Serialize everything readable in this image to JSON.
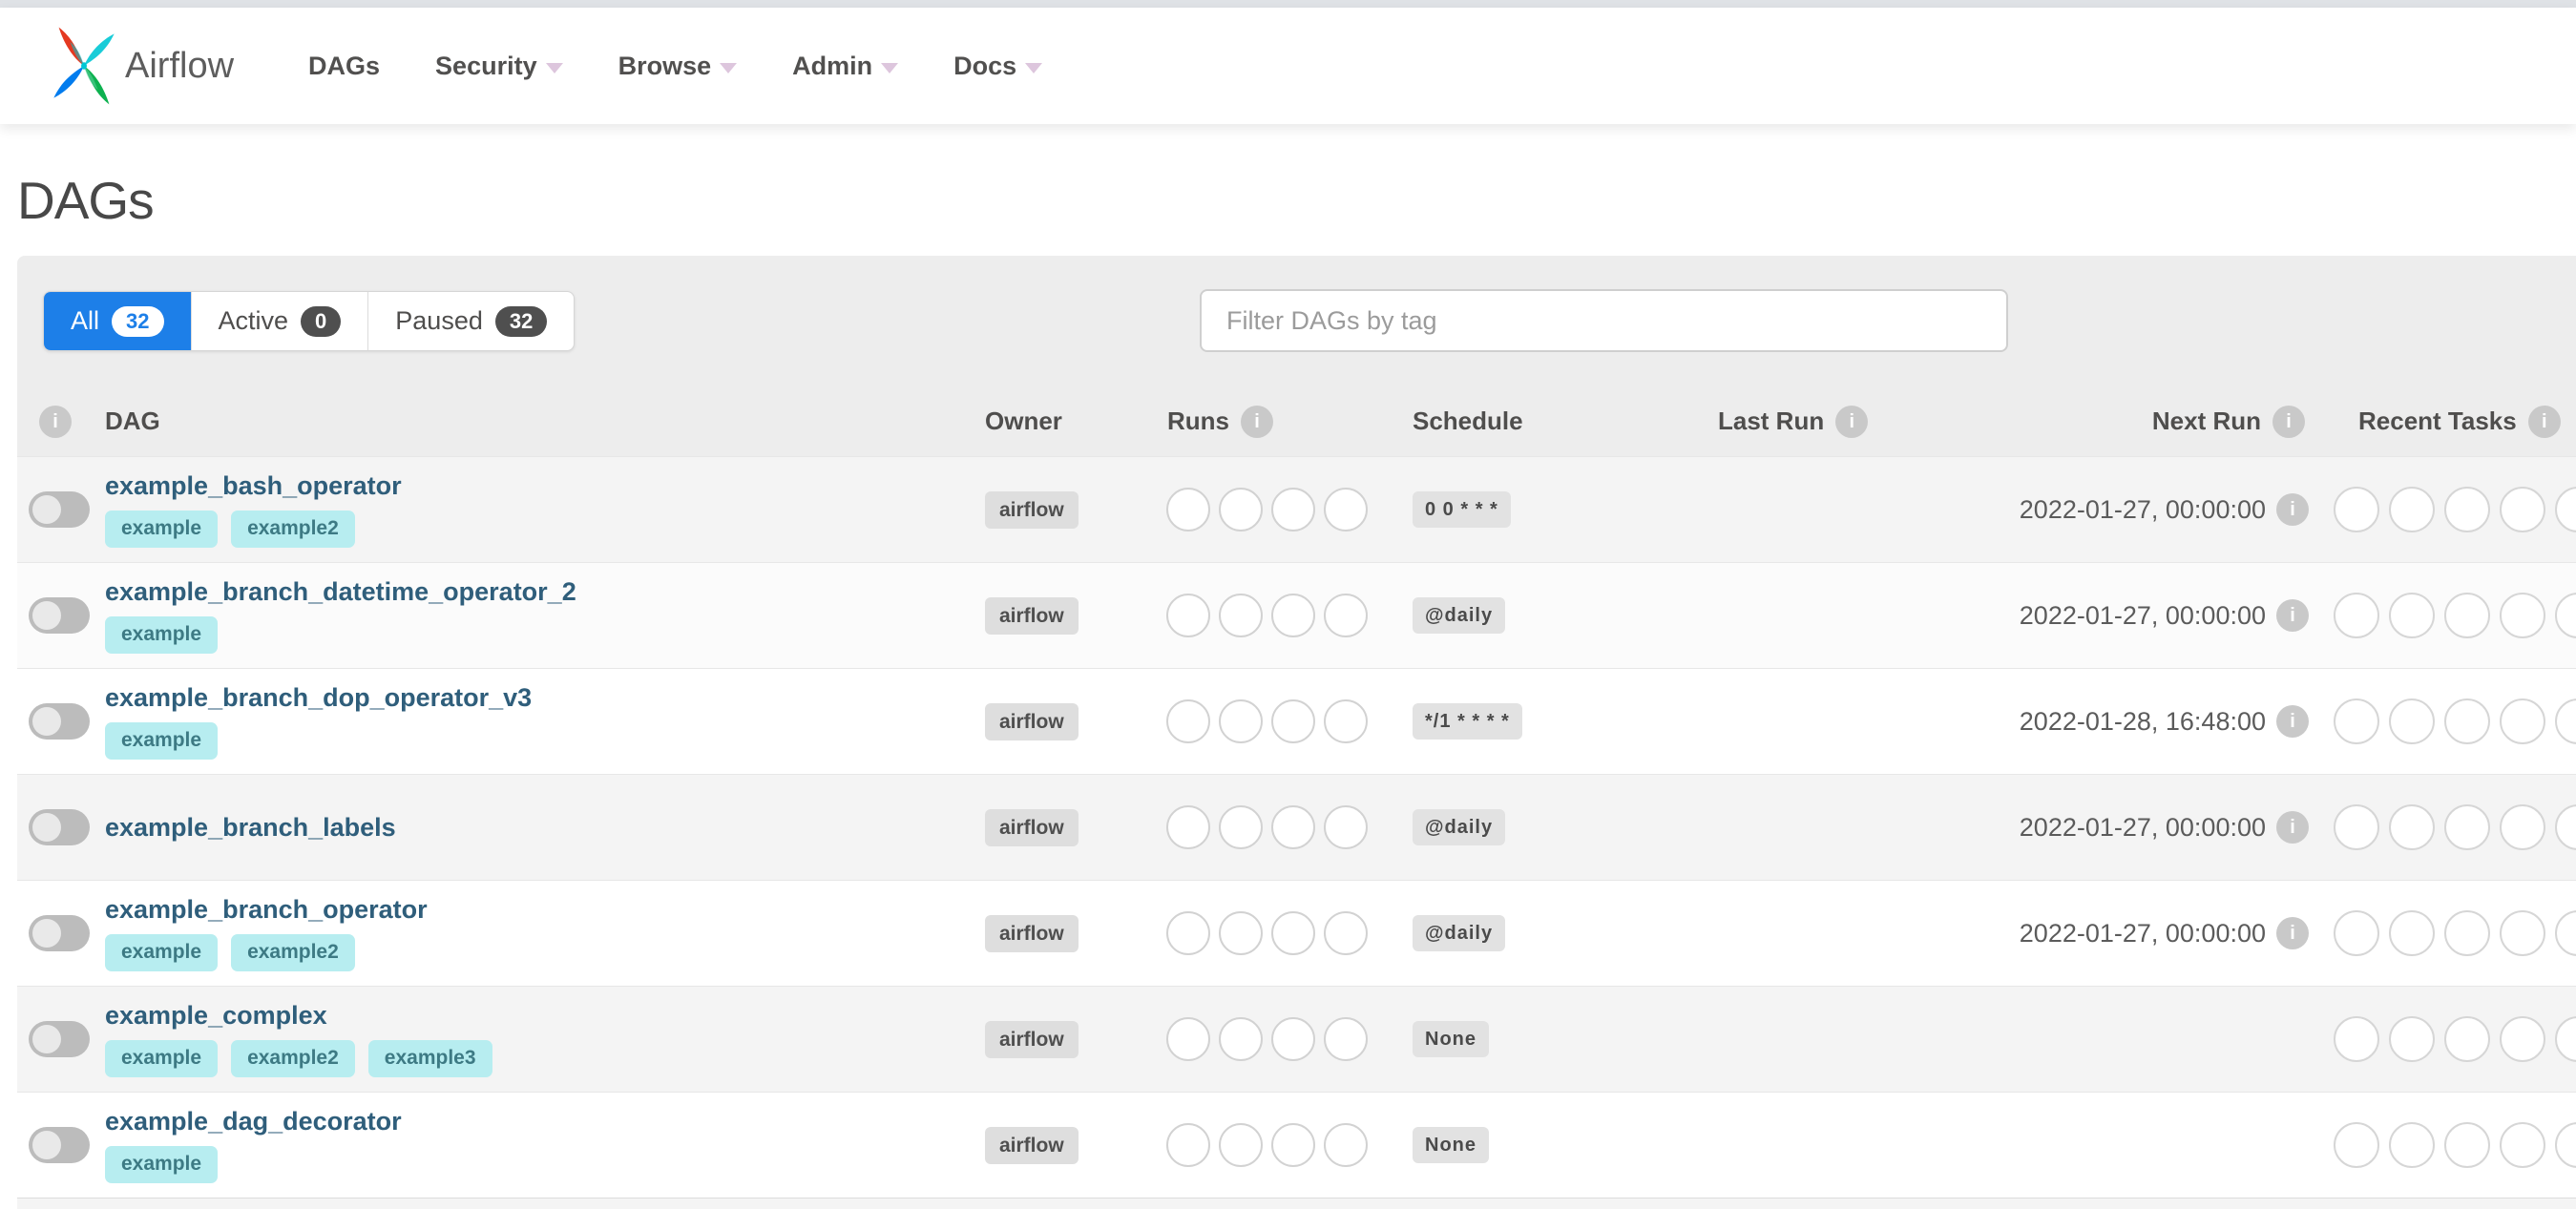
{
  "nav": {
    "brand": "Airflow",
    "items": [
      {
        "label": "DAGs",
        "caret": false
      },
      {
        "label": "Security",
        "caret": true
      },
      {
        "label": "Browse",
        "caret": true
      },
      {
        "label": "Admin",
        "caret": true
      },
      {
        "label": "Docs",
        "caret": true
      }
    ]
  },
  "page": {
    "title": "DAGs"
  },
  "filters": {
    "tabs": [
      {
        "label": "All",
        "count": "32",
        "active": true
      },
      {
        "label": "Active",
        "count": "0",
        "active": false
      },
      {
        "label": "Paused",
        "count": "32",
        "active": false
      }
    ],
    "search_placeholder": "Filter DAGs by tag"
  },
  "table": {
    "columns": [
      {
        "label": "DAG",
        "info": false
      },
      {
        "label": "Owner",
        "info": false
      },
      {
        "label": "Runs",
        "info": true
      },
      {
        "label": "Schedule",
        "info": false
      },
      {
        "label": "Last Run",
        "info": true
      },
      {
        "label": "Next Run",
        "info": true
      },
      {
        "label": "Recent Tasks",
        "info": true
      }
    ],
    "rows": [
      {
        "name": "example_bash_operator",
        "tags": [
          "example",
          "example2"
        ],
        "owner": "airflow",
        "runs_slots": 4,
        "schedule": "0 0 * * *",
        "last_run": "",
        "next_run": "2022-01-27, 00:00:00",
        "recent_slots": 5,
        "paused": true
      },
      {
        "name": "example_branch_datetime_operator_2",
        "tags": [
          "example"
        ],
        "owner": "airflow",
        "runs_slots": 4,
        "schedule": "@daily",
        "last_run": "",
        "next_run": "2022-01-27, 00:00:00",
        "recent_slots": 5,
        "paused": true
      },
      {
        "name": "example_branch_dop_operator_v3",
        "tags": [
          "example"
        ],
        "owner": "airflow",
        "runs_slots": 4,
        "schedule": "*/1 * * * *",
        "last_run": "",
        "next_run": "2022-01-28, 16:48:00",
        "recent_slots": 5,
        "paused": true
      },
      {
        "name": "example_branch_labels",
        "tags": [],
        "owner": "airflow",
        "runs_slots": 4,
        "schedule": "@daily",
        "last_run": "",
        "next_run": "2022-01-27, 00:00:00",
        "recent_slots": 5,
        "paused": true
      },
      {
        "name": "example_branch_operator",
        "tags": [
          "example",
          "example2"
        ],
        "owner": "airflow",
        "runs_slots": 4,
        "schedule": "@daily",
        "last_run": "",
        "next_run": "2022-01-27, 00:00:00",
        "recent_slots": 5,
        "paused": true
      },
      {
        "name": "example_complex",
        "tags": [
          "example",
          "example2",
          "example3"
        ],
        "owner": "airflow",
        "runs_slots": 4,
        "schedule": "None",
        "last_run": "",
        "next_run": "",
        "recent_slots": 5,
        "paused": true
      },
      {
        "name": "example_dag_decorator",
        "tags": [
          "example"
        ],
        "owner": "airflow",
        "runs_slots": 4,
        "schedule": "None",
        "last_run": "",
        "next_run": "",
        "recent_slots": 5,
        "paused": true
      }
    ]
  },
  "icons": {
    "info": "i",
    "nav_caret": "caret-down",
    "logo": "airflow-pinwheel"
  },
  "colors": {
    "accent_blue": "#1d7fe8",
    "tag_bg": "#b7edf0",
    "tag_text": "#3d7a84",
    "dag_link": "#2f5e7b",
    "badge_bg": "#dedede",
    "count_badge_bg": "#4f4f4f",
    "logo_red": "#e43921",
    "logo_cyan": "#00c7d4",
    "logo_blue": "#017cee",
    "logo_green": "#00ad46"
  }
}
